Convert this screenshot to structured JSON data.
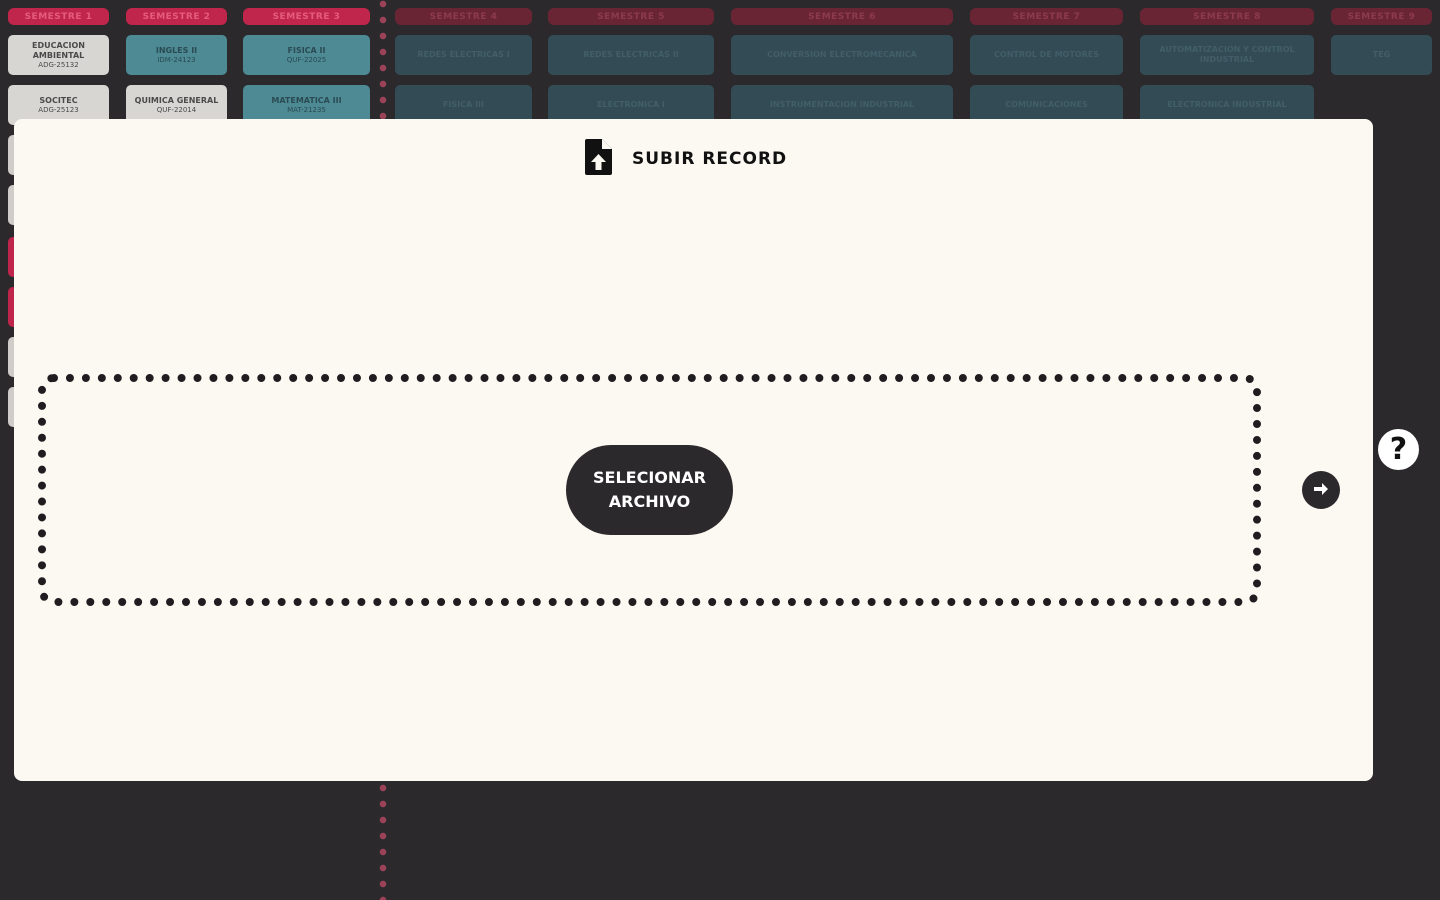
{
  "background": {
    "semesters": [
      "SEMESTRE 1",
      "SEMESTRE 2",
      "SEMESTRE 3",
      "SEMESTRE 4",
      "SEMESTRE 5",
      "SEMESTRE 6",
      "SEMESTRE 7",
      "SEMESTRE 8",
      "SEMESTRE 9"
    ],
    "courses": [
      {
        "title": "EDUCACION AMBIENTAL",
        "code": "ADG-25132"
      },
      {
        "title": "INGLES II",
        "code": "IDM-24123"
      },
      {
        "title": "FISICA II",
        "code": "QUF-22025"
      },
      {
        "title": "REDES ELECTRICAS I",
        "code": ""
      },
      {
        "title": "REDES ELECTRICAS II",
        "code": ""
      },
      {
        "title": "CONVERSION ELECTROMECANICA",
        "code": ""
      },
      {
        "title": "CONTROL DE MOTORES",
        "code": ""
      },
      {
        "title": "AUTOMATIZACION Y CONTROL INDUSTRIAL",
        "code": ""
      },
      {
        "title": "TEG",
        "code": ""
      },
      {
        "title": "SOCITEC",
        "code": "ADG-25123"
      },
      {
        "title": "QUIMICA GENERAL",
        "code": "QUF-22014"
      },
      {
        "title": "MATEMATICA III",
        "code": "MAT-21235"
      },
      {
        "title": "FISICA III",
        "code": ""
      },
      {
        "title": "ELECTRONICA I",
        "code": ""
      },
      {
        "title": "INSTRUMENTACION INDUSTRIAL",
        "code": ""
      },
      {
        "title": "COMUNICACIONES",
        "code": ""
      },
      {
        "title": "ELECTRONICA INDUSTRIAL",
        "code": ""
      }
    ]
  },
  "modal": {
    "title": "SUBIR RECORD",
    "title_icon": "file-upload-icon",
    "select_button": {
      "line1": "SELECIONAR",
      "line2": "ARCHIVO"
    },
    "next_icon": "arrow-right-icon"
  },
  "help": {
    "label": "?"
  },
  "colors": {
    "background": "#2b292c",
    "modal": "#fcf9f2",
    "accent": "#c0254b",
    "button": "#2b292c"
  }
}
